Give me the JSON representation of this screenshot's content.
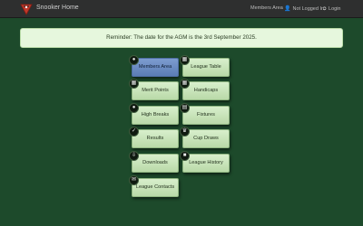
{
  "navbar": {
    "brand": "Snooker Home",
    "links": [
      {
        "label": "Members Area",
        "icon": ""
      },
      {
        "label": "Not Logged In",
        "icon": "user-icon"
      },
      {
        "label": "Login",
        "icon": "login-icon"
      }
    ]
  },
  "alert": {
    "text": "Reminder: The date for the AGM is the 3rd September 2025."
  },
  "tiles": [
    {
      "label": "Members Area",
      "icon": "user-icon",
      "active": true
    },
    {
      "label": "League Table",
      "icon": "grid-icon",
      "active": false
    },
    {
      "label": "Merit Points",
      "icon": "grid-icon",
      "active": false
    },
    {
      "label": "Handicaps",
      "icon": "grid-icon",
      "active": false
    },
    {
      "label": "High Breaks",
      "icon": "circle-icon",
      "active": false
    },
    {
      "label": "Fixtures",
      "icon": "calendar-icon",
      "active": false
    },
    {
      "label": "Results",
      "icon": "check-icon",
      "active": false
    },
    {
      "label": "Cup Draws",
      "icon": "trophy-icon",
      "active": false
    },
    {
      "label": "Downloads",
      "icon": "download-icon",
      "active": false
    },
    {
      "label": "League History",
      "icon": "book-icon",
      "active": false
    },
    {
      "label": "League Contacts",
      "icon": "envelope-icon",
      "active": false
    }
  ],
  "colors": {
    "background": "#1d4a2b",
    "navbar": "#2e2f2f",
    "tile": "#c8e4b8",
    "tile_active": "#6a8bc2",
    "alert": "#e6f7dd"
  }
}
